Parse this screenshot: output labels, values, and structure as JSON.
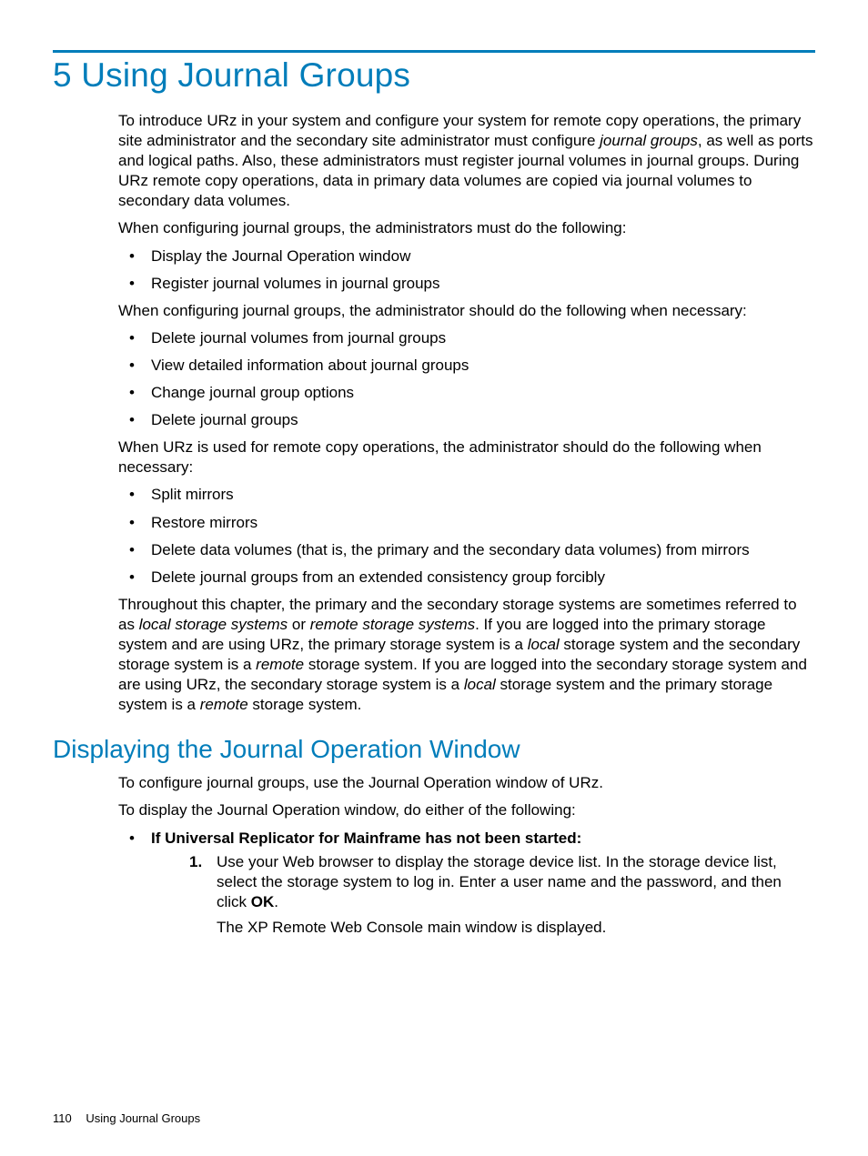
{
  "chapter_title": "5 Using Journal Groups",
  "intro_html": "To introduce URz in your system and configure your system for remote copy operations, the primary site administrator and the secondary site administrator must configure <em>journal groups</em>, as well as ports and logical paths. Also, these administrators must register journal volumes in journal groups. During URz remote copy operations, data in primary data volumes are copied via journal volumes to secondary data volumes.",
  "p_must": "When configuring journal groups, the administrators must do the following:",
  "list_must": [
    "Display the Journal Operation window",
    "Register journal volumes in journal groups"
  ],
  "p_should": "When configuring journal groups, the administrator should do the following when necessary:",
  "list_should": [
    "Delete journal volumes from journal groups",
    "View detailed information about journal groups",
    "Change journal group options",
    "Delete journal groups"
  ],
  "p_remote": "When URz is used for remote copy operations, the administrator should do the following when necessary:",
  "list_remote": [
    "Split mirrors",
    "Restore mirrors",
    "Delete data volumes (that is, the primary and the secondary data volumes) from mirrors",
    "Delete journal groups from an extended consistency group forcibly"
  ],
  "p_throughout_html": "Throughout this chapter, the primary and the secondary storage systems are sometimes referred to as <em>local storage systems</em> or <em>remote storage systems</em>. If you are logged into the primary storage system and are using URz, the primary storage system is a <em>local</em> storage system and the secondary storage system is a <em>remote</em> storage system. If you are logged into the secondary storage system and are using URz, the secondary storage system is a <em>local</em> storage system and the primary storage system is a <em>remote</em> storage system.",
  "section_title": "Displaying the Journal Operation Window",
  "p_configure": "To configure journal groups, use the Journal Operation window of URz.",
  "p_display": "To display the Journal Operation window, do either of the following:",
  "bullet_started_html": "<strong>If Universal Replicator for Mainframe has not been started:</strong>",
  "step1_num": "1.",
  "step1_html": "Use your Web browser to display the storage device list. In the storage device list, select the storage system to log in. Enter a user name and the password, and then click <strong>OK</strong>.",
  "step1_after": "The XP Remote Web Console main window is displayed.",
  "footer": {
    "page_number": "110",
    "section": "Using Journal Groups"
  }
}
